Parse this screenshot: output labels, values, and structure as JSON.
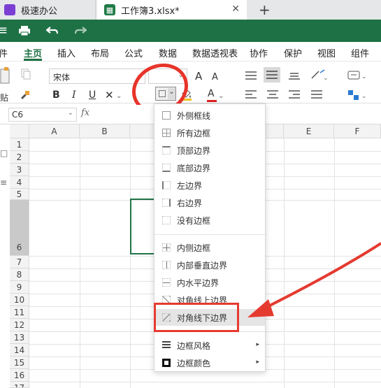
{
  "tabs": [
    {
      "label": "极速办公"
    },
    {
      "label": "工作簿3.xlsx*"
    }
  ],
  "new_tab": "+",
  "close": "✕",
  "toolbar_icons": [
    "print-icon",
    "undo-icon",
    "redo-icon"
  ],
  "menu": [
    "件",
    "主页",
    "插入",
    "布局",
    "公式",
    "数据",
    "数据透视表",
    "协作",
    "保护",
    "视图",
    "组件"
  ],
  "ribbon": {
    "paste_label": "贴",
    "font_name": "宋体",
    "font_size": "",
    "bold": "B",
    "italic": "I",
    "underline": "U",
    "increase_font": "A",
    "decrease_font": "A",
    "font_color_glyph": "A"
  },
  "cell_ref": "C6",
  "fx": "fx",
  "columns": [
    "A",
    "B",
    "",
    "",
    "E",
    "F"
  ],
  "rows": [
    "1",
    "2",
    "3",
    "4",
    "5",
    "6",
    "7",
    "8",
    "9",
    "10",
    "11",
    "12",
    "13",
    "14",
    "15",
    "16",
    "17"
  ],
  "border_menu": {
    "items": [
      "外侧框线",
      "所有边框",
      "顶部边界",
      "底部边界",
      "左边界",
      "右边界",
      "没有边框",
      "内侧边框",
      "内部垂直边界",
      "内水平边界",
      "对角线上边界",
      "对角线下边界",
      "边框风格",
      "边框颜色"
    ]
  },
  "colors": {
    "brand_green": "#1e7145",
    "annotation_red": "#e53a30"
  }
}
